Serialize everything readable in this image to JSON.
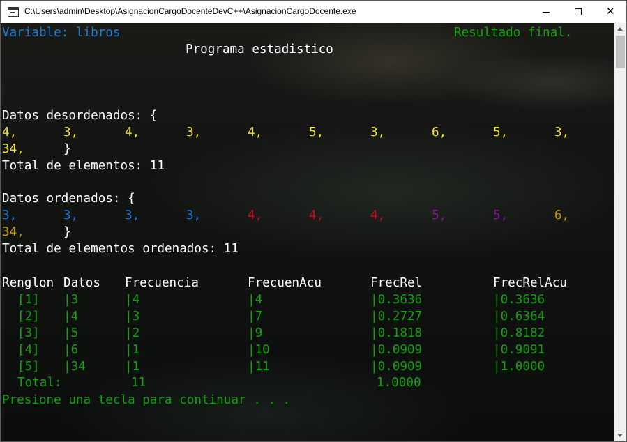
{
  "window": {
    "title": "C:\\Users\\admin\\Desktop\\AsignacionCargoDocenteDevC++\\AsignacionCargoDocente.exe"
  },
  "titlebar": {
    "minimize": "minimize-icon",
    "maximize": "maximize-icon",
    "close": "✕"
  },
  "colors": {
    "white": "#ffffff",
    "blue": "#1e7ad6",
    "green": "#13a10e",
    "yellow": "#f2e62a",
    "red": "#c50f1f",
    "purple": "#881798",
    "olive": "#c19c00"
  },
  "console": {
    "variable": "Variable: libros",
    "result": "Resultado final.",
    "title": "Programa estadistico",
    "unordered_header": "Datos desordenados: {",
    "unordered_values": [
      "4,",
      "3,",
      "4,",
      "3,",
      "4,",
      "5,",
      "3,",
      "6,",
      "5,",
      "3,"
    ],
    "unordered_last": "34,",
    "brace": "}",
    "total_unordered": "Total de elementos: 11",
    "ordered_header": "Datos ordenados: {",
    "ordered_values": [
      "3,",
      "3,",
      "3,",
      "3,",
      "4,",
      "4,",
      "4,",
      "5,",
      "5,",
      "6,"
    ],
    "ordered_last": "34,",
    "total_ordered": "Total de elementos ordenados: 11",
    "table": {
      "headers": [
        "Renglon",
        "Datos",
        "Frecuencia",
        "FrecuenAcu",
        "FrecRel",
        "FrecRelAcu"
      ],
      "rows": [
        [
          "[1]",
          "|3",
          "|4",
          "|4",
          "|0.3636",
          "|0.3636"
        ],
        [
          "[2]",
          "|4",
          "|3",
          "|7",
          "|0.2727",
          "|0.6364"
        ],
        [
          "[3]",
          "|5",
          "|2",
          "|9",
          "|0.1818",
          "|0.8182"
        ],
        [
          "[4]",
          "|6",
          "|1",
          "|10",
          "|0.0909",
          "|0.9091"
        ],
        [
          "[5]",
          "|34",
          "|1",
          "|11",
          "|0.0909",
          "|1.0000"
        ]
      ],
      "total_label": "Total:",
      "total_freq": "11",
      "total_rel": "1.0000"
    },
    "prompt": "Presione una tecla para continuar . . ."
  },
  "scrollbar": {
    "up": "scroll-up-arrow",
    "down": "scroll-down-arrow"
  }
}
